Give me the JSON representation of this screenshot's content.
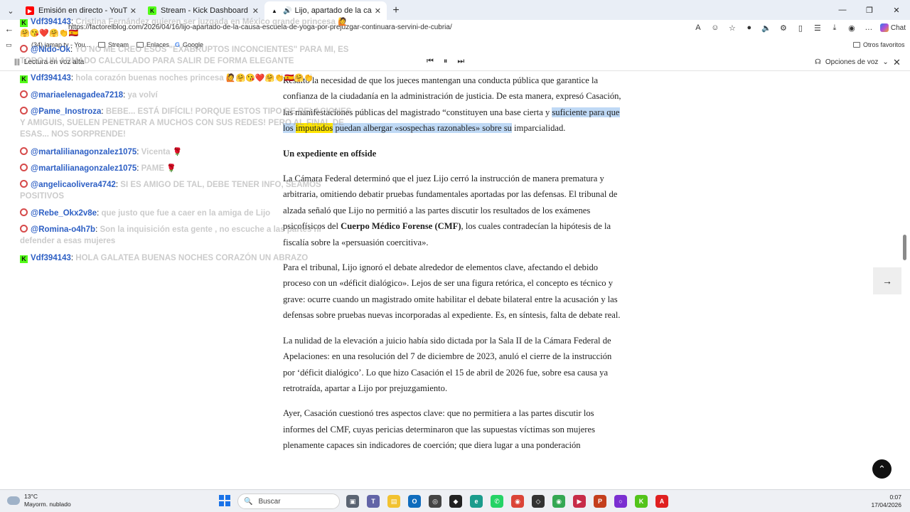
{
  "browser": {
    "tabs": [
      {
        "title": "Emisión en directo - YouTube Studio",
        "favicon": "youtube-icon"
      },
      {
        "title": "Stream - Kick Dashboard",
        "favicon": "kick-icon"
      },
      {
        "title": "Lijo, apartado de la causa Escuela de Yoga",
        "favicon": "site-icon",
        "active": true
      }
    ],
    "url": "https://factorelblog.com/2026/04/16/lijo-apartado-de-la-causa-escuela-de-yoga-por-prejuzgar-continuara-servini-de-cubria/",
    "copilot_label": "Chat",
    "bookmarks": [
      "(34) jamap.tv - You...",
      "Stream",
      "Enlaces",
      "Google"
    ],
    "other_bookmarks": "Otros favoritos"
  },
  "reader": {
    "label": "Lectura en voz alta",
    "voice_options": "Opciones de voz"
  },
  "article": {
    "p1_before": "Resaltó la necesidad de que los jueces mantengan una conducta pública que garantice la confianza de la ciudadanía en la administración de justicia. De esta manera, expresó Casación, las manifestaciones públicas del magistrado “constituyen una base cierta y ",
    "p1_hl_a": "suficiente para que los ",
    "p1_hl_word": "imputados",
    "p1_hl_b": " puedan albergar «sospechas razonables» sobre su",
    "p1_after": " imparcialidad.",
    "heading": "Un expediente en offside",
    "p2_a": "La Cámara Federal determinó que el juez Lijo cerró la instrucción de manera prematura y arbitraria, omitiendo debatir pruebas fundamentales aportadas por las defensas. El tribunal de alzada señaló que Lijo no permitió a las partes discutir los resultados de los exámenes psicofísicos del ",
    "p2_bold": "Cuerpo Médico Forense (CMF)",
    "p2_b": ", los cuales contradecían la hipótesis de la fiscalía sobre la «persuasión coercitiva».",
    "p3": "Para el tribunal, Lijo ignoró el debate alrededor de elementos clave, afectando el debido proceso con un «déficit dialógico». Lejos de ser una figura retórica, el concepto es técnico y grave: ocurre cuando un magistrado omite habilitar el debate bilateral entre la acusación y las defensas sobre pruebas nuevas incorporadas al expediente. Es, en síntesis, falta de debate real.",
    "p4": "La nulidad de la elevación a juicio había sido dictada por la Sala II de la Cámara Federal de Apelaciones: en una resolución del 7 de diciembre de 2023, anuló el cierre de la instrucción por ‘déficit dialógico’. Lo que hizo Casación el 15 de abril de 2026 fue, sobre esa causa ya retrotraída, apartar a Lijo por prejuzgamiento.",
    "p5": "Ayer, Casación cuestionó tres aspectos clave: que no permitiera a las partes discutir los informes del CMF, cuyas pericias determinaron que las supuestas víctimas son mujeres plenamente capaces sin indicadores de coerción; que diera lugar a una ponderación"
  },
  "chat": [
    {
      "platform": "kick",
      "user": "Vdf394143",
      "text": "Cristina Fernández quieren ser juzgada en México grande princesa",
      "emoji": "🙋🤗😘❤️🤗👏🇪🇸"
    },
    {
      "platform": "youtube",
      "user": "@Nido-Ok",
      "text": "YO NO ME CREO ESOS \"EXABRUPTOS INCONCIENTES\" PARA MI, ES TODO UN ARMADO CALCULADO PARA SALIR DE FORMA ELEGANTE",
      "emoji": ""
    },
    {
      "platform": "kick",
      "user": "Vdf394143",
      "text": "hola corazón buenas noches princesa",
      "emoji": "🙋🤗😘❤️🤗👏🇪🇸🤗👏"
    },
    {
      "platform": "youtube",
      "user": "@mariaelenagadea7218",
      "text": "ya volví",
      "emoji": ""
    },
    {
      "platform": "youtube",
      "user": "@Pame_Inostroza",
      "text": "BEBE... ESTÁ DIFÍCIL! PORQUE ESTOS TIPO DE RELACIONES Y AMIGUIS, SUELEN PENETRAR A MUCHOS CON SUS REDES! PERO AL FINAL DE ESAS... NOS SORPRENDE!",
      "emoji": ""
    },
    {
      "platform": "youtube",
      "user": "@martalilianagonzalez1075",
      "text": "Vicenta",
      "emoji": "🌹"
    },
    {
      "platform": "youtube",
      "user": "@martalilianagonzalez1075",
      "text": "PAME",
      "emoji": "🌹"
    },
    {
      "platform": "youtube",
      "user": "@angelicaolivera4742",
      "text": "SI ES AMIGO DE TAL, DEBE TENER INFO, SEAMOS POSITIVOS",
      "emoji": ""
    },
    {
      "platform": "youtube",
      "user": "@Rebe_Okx2v8e",
      "text": "que justo que fue a caer en la amiga de Lijo",
      "emoji": ""
    },
    {
      "platform": "youtube",
      "user": "@Romina-o4h7b",
      "text": "Son la inquisición esta gente , no escuche a las partes ni defender a esas mujeres",
      "emoji": ""
    },
    {
      "platform": "kick",
      "user": "Vdf394143",
      "text": "HOLA GALATEA BUENAS NOCHES CORAZÓN UN ABRAZO",
      "emoji": ""
    }
  ],
  "taskbar": {
    "temperature": "13°C",
    "weather": "Mayorm. nublado",
    "search_placeholder": "Buscar",
    "time": "0:07",
    "date": "17/04/2026"
  }
}
